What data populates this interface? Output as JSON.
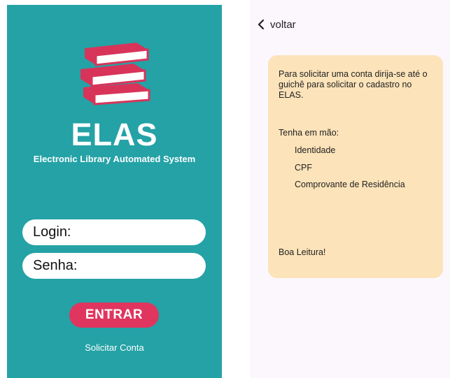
{
  "login_screen": {
    "brand": {
      "title": "ELAS",
      "subtitle": "Electronic Library Automated System",
      "logo_icon": "books-stack-icon"
    },
    "login_field": {
      "placeholder": "Login:",
      "value": ""
    },
    "password_field": {
      "placeholder": "Senha:",
      "value": ""
    },
    "enter_label": "ENTRAR",
    "request_account_label": "Solicitar Conta",
    "colors": {
      "background": "#24a2a6",
      "accent": "#e0355f",
      "books": "#d8345a"
    }
  },
  "request_screen": {
    "back_label": "voltar",
    "back_icon": "chevron-left-icon",
    "card": {
      "instructions": "Para solicitar uma conta dirija-se até o guichê para solicitar o cadastro no ELAS.",
      "have_label": "Tenha em mão:",
      "documents": [
        "Identidade",
        "CPF",
        "Comprovante de Residência"
      ],
      "farewell": "Boa Leitura!"
    },
    "colors": {
      "background": "#fcf7fd",
      "card": "#fce3b9"
    }
  }
}
